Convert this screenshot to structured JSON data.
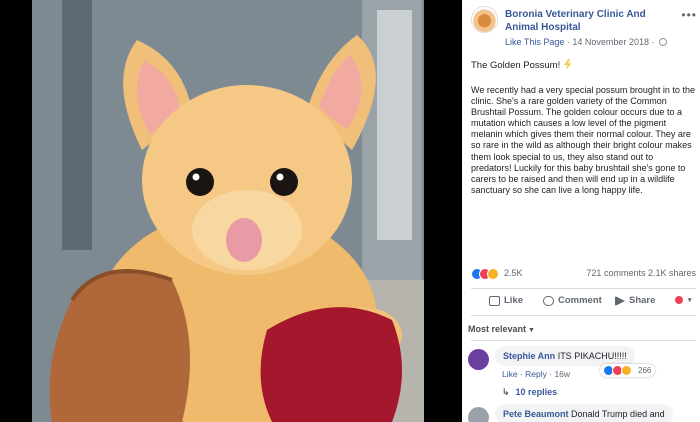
{
  "post": {
    "page_name": "Boronia Veterinary Clinic And Animal Hospital",
    "like_page": "Like This Page",
    "separator": "·",
    "date": "14 November 2018",
    "more_icon": "more-icon",
    "title": "The Golden Possum!",
    "body": "We recently had a very special possum brought in to the clinic. She's a rare golden variety of the Common Brushtail Possum. The golden colour occurs due to a mutation which causes a low level of the pigment melanin which gives them their normal colour. They are so rare in the wild as although their bright colour makes them look special to us, they also stand out to predators! Luckily for this baby brushtail she's gone to carers to be raised and then will end up in a wildlife sanctuary so she can live a long happy life."
  },
  "stats": {
    "reactions_count": "2.5K",
    "comments": "721 comments",
    "shares": "2.1K shares"
  },
  "actions": {
    "like": "Like",
    "comment": "Comment",
    "share": "Share"
  },
  "comments": {
    "sort_label": "Most relevant",
    "items": [
      {
        "author": "Stephie Ann",
        "text": "ITS PIKACHU!!!!!",
        "like": "Like",
        "reply": "Reply",
        "age": "16w",
        "reaction_count": "266",
        "replies": "10 replies"
      },
      {
        "author": "Pete Beaumont",
        "text": "Donald Trump died and"
      }
    ]
  },
  "colors": {
    "link": "#385898",
    "possum_fur": "#f4c77e",
    "background": "#ffffff"
  }
}
